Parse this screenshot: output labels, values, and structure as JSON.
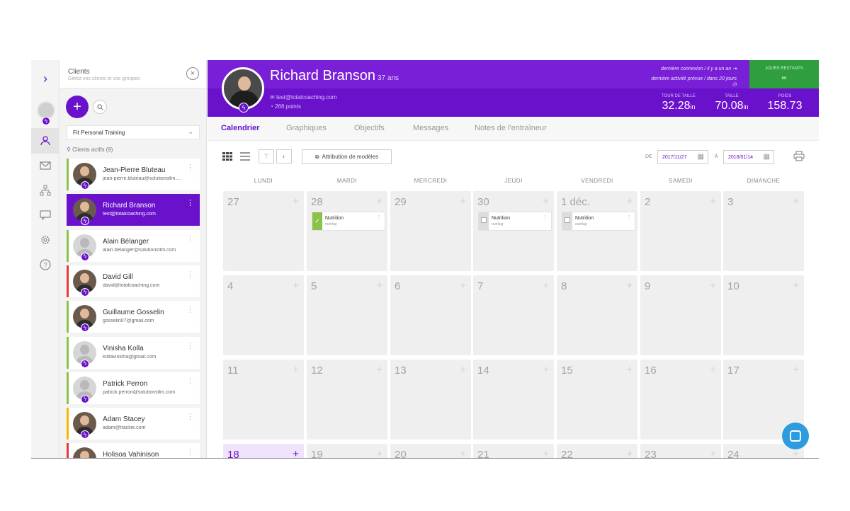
{
  "sidebar_rail": {
    "items": [
      {
        "name": "expand",
        "icon": "chevron-right-icon"
      },
      {
        "name": "profile",
        "icon": "avatar"
      },
      {
        "name": "clients",
        "icon": "users-icon",
        "active": true
      },
      {
        "name": "messages",
        "icon": "mail-icon"
      },
      {
        "name": "groups",
        "icon": "org-chart-icon"
      },
      {
        "name": "chat",
        "icon": "chat-icon"
      },
      {
        "name": "settings",
        "icon": "gear-icon"
      },
      {
        "name": "help",
        "icon": "help-icon"
      }
    ]
  },
  "client_panel": {
    "title": "Clients",
    "subtitle": "Gérez vos clients et vos groupes",
    "group": "Fit Personal Training",
    "active_label": "Clients actifs (9)",
    "clients": [
      {
        "name": "Jean-Pierre Bluteau",
        "email": "jean-pierre.bluteau@solutionstlm.com",
        "accent": "#8bc34a",
        "photo": true
      },
      {
        "name": "Richard Branson",
        "email": "test@totalcoaching.com",
        "accent": "#6a11cb",
        "photo": true,
        "selected": true
      },
      {
        "name": "Alain Bélanger",
        "email": "alain.belanger@solutionstlm.com",
        "accent": "#8bc34a",
        "photo": false
      },
      {
        "name": "David Gill",
        "email": "david@totalcoaching.com",
        "accent": "#e53935",
        "photo": true
      },
      {
        "name": "Guillaume Gosselin",
        "email": "gosselin07@gmail.com",
        "accent": "#8bc34a",
        "photo": true
      },
      {
        "name": "Vinisha Kolla",
        "email": "kollavinisha@gmail.com",
        "accent": "#8bc34a",
        "photo": false
      },
      {
        "name": "Patrick Perron",
        "email": "patrick.perron@solutionstlm.com",
        "accent": "#8bc34a",
        "photo": false
      },
      {
        "name": "Adam Stacey",
        "email": "adam@trackie.com",
        "accent": "#f5b800",
        "photo": true
      },
      {
        "name": "Holisoa Vahinison",
        "email": "",
        "accent": "#e53935",
        "photo": true
      }
    ]
  },
  "profile": {
    "name": "Richard Branson",
    "age": "37 ans",
    "email": "test@totalcoaching.com",
    "points": "266 points",
    "last_login": "dernière connexion / il y a un an",
    "last_activity": "dernière activité prévue / dans 20 jours",
    "days_label": "JOURS RESTANTS",
    "days_value": "∞",
    "metrics": [
      {
        "label": "TOUR DE TAILLE",
        "value": "32.28",
        "unit": "in"
      },
      {
        "label": "TAILLE",
        "value": "70.08",
        "unit": "in"
      },
      {
        "label": "POIDS",
        "value": "158.73",
        "unit": ""
      }
    ]
  },
  "tabs": [
    "Calendrier",
    "Graphiques",
    "Objectifs",
    "Messages",
    "Notes de l'entraîneur"
  ],
  "toolbar": {
    "model_button": "Attribution de modèles",
    "from_label": "DE",
    "from_date": "2017/11/27",
    "to_label": "À",
    "to_date": "2018/01/14"
  },
  "calendar": {
    "days_of_week": [
      "LUNDI",
      "MARDI",
      "MERCREDI",
      "JEUDI",
      "VENDREDI",
      "SAMEDI",
      "DIMANCHE"
    ],
    "weeks": [
      [
        "27",
        "28",
        "29",
        "30",
        "1 déc.",
        "2",
        "3"
      ],
      [
        "4",
        "5",
        "6",
        "7",
        "8",
        "9",
        "10"
      ],
      [
        "11",
        "12",
        "13",
        "14",
        "15",
        "16",
        "17"
      ],
      [
        "18",
        "19",
        "20",
        "21",
        "22",
        "23",
        "24"
      ]
    ],
    "today": "18",
    "events": [
      {
        "week": 0,
        "day": 1,
        "title": "Nutrition",
        "subtitle": "nutrilog",
        "done": true
      },
      {
        "week": 0,
        "day": 3,
        "title": "Nutrition",
        "subtitle": "nutrilog",
        "done": false
      },
      {
        "week": 0,
        "day": 4,
        "title": "Nutrition",
        "subtitle": "nutrilog",
        "done": false
      }
    ]
  },
  "colors": {
    "brand": "#6a11cb",
    "success": "#2e9e3e",
    "chat": "#2c9be0"
  }
}
